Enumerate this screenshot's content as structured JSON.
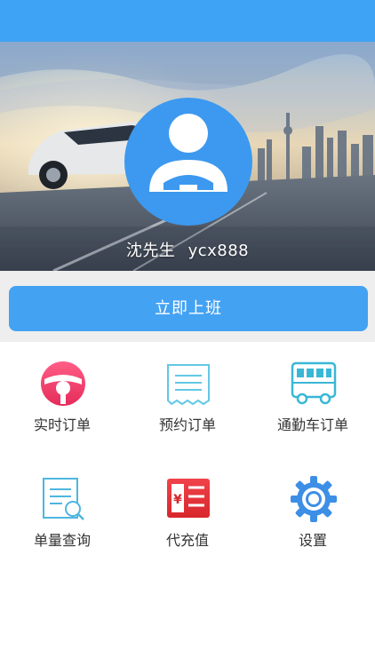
{
  "user": {
    "name": "沈先生",
    "id": "ycx888"
  },
  "cta": {
    "label": "立即上班"
  },
  "menu": [
    {
      "label": "实时订单",
      "icon": "steering-wheel-icon"
    },
    {
      "label": "预约订单",
      "icon": "receipt-icon"
    },
    {
      "label": "通勤车订单",
      "icon": "bus-icon"
    },
    {
      "label": "单量查询",
      "icon": "document-search-icon"
    },
    {
      "label": "代充值",
      "icon": "recharge-icon"
    },
    {
      "label": "设置",
      "icon": "gear-icon"
    }
  ],
  "colors": {
    "primary": "#44a2f3",
    "status_bar": "#3fa3f5",
    "avatar": "#3c99ef"
  }
}
